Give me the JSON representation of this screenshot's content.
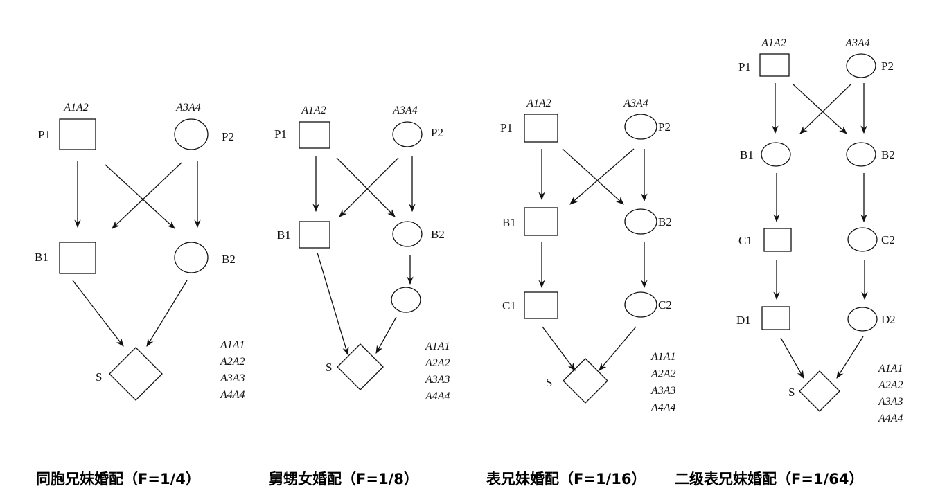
{
  "diagrams": [
    {
      "caption": "同胞兄妹婚配（F=1/4）",
      "parent_genotypes": [
        "A1A2",
        "A3A4"
      ],
      "nodes": [
        "P1",
        "P2",
        "B1",
        "B2",
        "S"
      ],
      "offspring_genotypes": [
        "A1A1",
        "A2A2",
        "A3A3",
        "A4A4"
      ]
    },
    {
      "caption": "舅甥女婚配（F=1/8）",
      "parent_genotypes": [
        "A1A2",
        "A3A4"
      ],
      "nodes": [
        "P1",
        "P2",
        "B1",
        "B2",
        "",
        "S"
      ],
      "offspring_genotypes": [
        "A1A1",
        "A2A2",
        "A3A3",
        "A4A4"
      ]
    },
    {
      "caption": "表兄妹婚配（F=1/16）",
      "parent_genotypes": [
        "A1A2",
        "A3A4"
      ],
      "nodes": [
        "P1",
        "P2",
        "B1",
        "B2",
        "C1",
        "C2",
        "S"
      ],
      "offspring_genotypes": [
        "A1A1",
        "A2A2",
        "A3A3",
        "A4A4"
      ]
    },
    {
      "caption": "二级表兄妹婚配（F=1/64）",
      "parent_genotypes": [
        "A1A2",
        "A3A4"
      ],
      "nodes": [
        "P1",
        "P2",
        "B1",
        "B2",
        "C1",
        "C2",
        "D1",
        "D2",
        "S"
      ],
      "offspring_genotypes": [
        "A1A1",
        "A2A2",
        "A3A3",
        "A4A4"
      ]
    }
  ],
  "legend": {
    "square": "male",
    "circle": "female",
    "diamond": "offspring"
  },
  "colors": {
    "stroke": "#111111",
    "background": "#ffffff"
  }
}
